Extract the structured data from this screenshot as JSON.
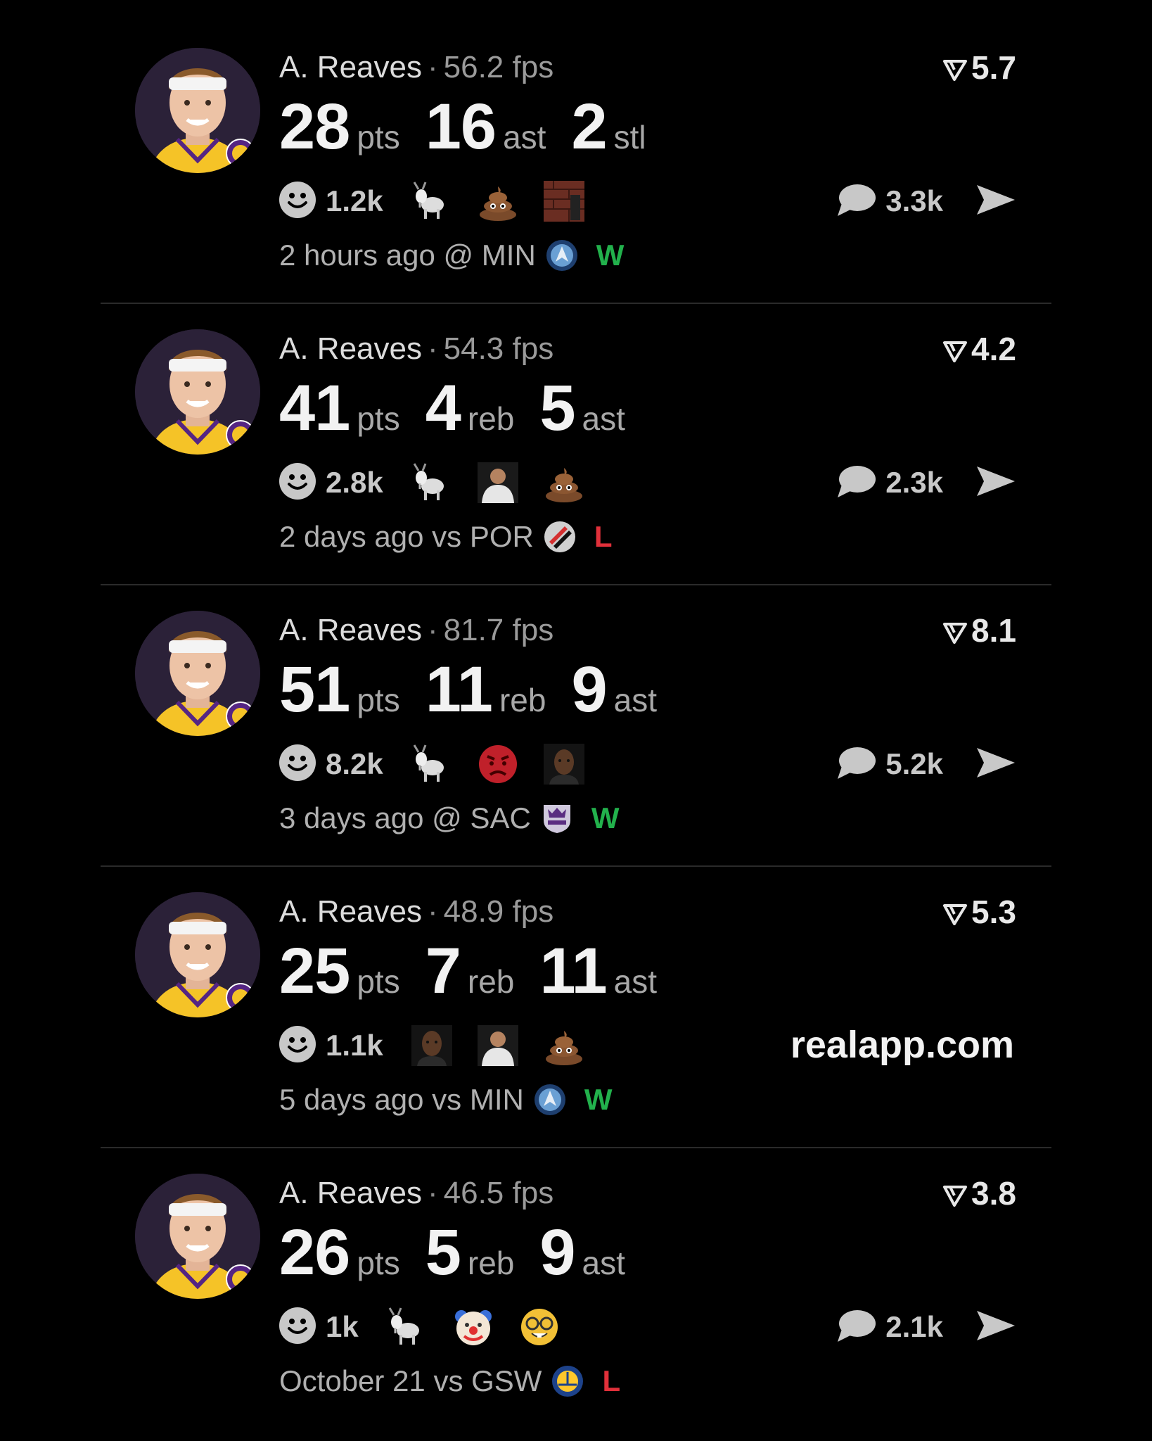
{
  "brand": "realapp.com",
  "colors": {
    "background": "#000000",
    "win": "#22b14c",
    "loss": "#e0303a",
    "avatar_bg": "#2b2138",
    "lakers_gold": "#f5c327",
    "lakers_purple": "#552583"
  },
  "cards": [
    {
      "player": "A. Reaves",
      "fps": "56.2 fps",
      "rating": "5.7",
      "stats": [
        {
          "value": "28",
          "unit": "pts"
        },
        {
          "value": "16",
          "unit": "ast"
        },
        {
          "value": "2",
          "unit": "stl"
        }
      ],
      "reaction_count": "1.2k",
      "reactions": [
        "goat",
        "poop",
        "photo-brick"
      ],
      "comments": "3.3k",
      "show_share": true,
      "game": "2 hours ago @ MIN",
      "team_logo": "timberwolves-logo",
      "result": "W"
    },
    {
      "player": "A. Reaves",
      "fps": "54.3 fps",
      "rating": "4.2",
      "stats": [
        {
          "value": "41",
          "unit": "pts"
        },
        {
          "value": "4",
          "unit": "reb"
        },
        {
          "value": "5",
          "unit": "ast"
        }
      ],
      "reaction_count": "2.8k",
      "reactions": [
        "goat",
        "photo-person",
        "poop"
      ],
      "comments": "2.3k",
      "show_share": true,
      "game": "2 days ago vs POR",
      "team_logo": "blazers-logo",
      "result": "L"
    },
    {
      "player": "A. Reaves",
      "fps": "81.7 fps",
      "rating": "8.1",
      "stats": [
        {
          "value": "51",
          "unit": "pts"
        },
        {
          "value": "11",
          "unit": "reb"
        },
        {
          "value": "9",
          "unit": "ast"
        }
      ],
      "reaction_count": "8.2k",
      "reactions": [
        "goat",
        "angry",
        "photo-face"
      ],
      "comments": "5.2k",
      "show_share": true,
      "game": "3 days ago @ SAC",
      "team_logo": "kings-logo",
      "result": "W"
    },
    {
      "player": "A. Reaves",
      "fps": "48.9 fps",
      "rating": "5.3",
      "stats": [
        {
          "value": "25",
          "unit": "pts"
        },
        {
          "value": "7",
          "unit": "reb"
        },
        {
          "value": "11",
          "unit": "ast"
        }
      ],
      "reaction_count": "1.1k",
      "reactions": [
        "photo-face",
        "photo-person",
        "poop"
      ],
      "comments": "",
      "show_share": false,
      "game": "5 days ago vs MIN",
      "team_logo": "timberwolves-logo",
      "result": "W"
    },
    {
      "player": "A. Reaves",
      "fps": "46.5 fps",
      "rating": "3.8",
      "stats": [
        {
          "value": "26",
          "unit": "pts"
        },
        {
          "value": "5",
          "unit": "reb"
        },
        {
          "value": "9",
          "unit": "ast"
        }
      ],
      "reaction_count": "1k",
      "reactions": [
        "goat",
        "clown",
        "nerd"
      ],
      "comments": "2.1k",
      "show_share": true,
      "game": "October 21 vs GSW",
      "team_logo": "warriors-logo",
      "result": "L"
    }
  ]
}
